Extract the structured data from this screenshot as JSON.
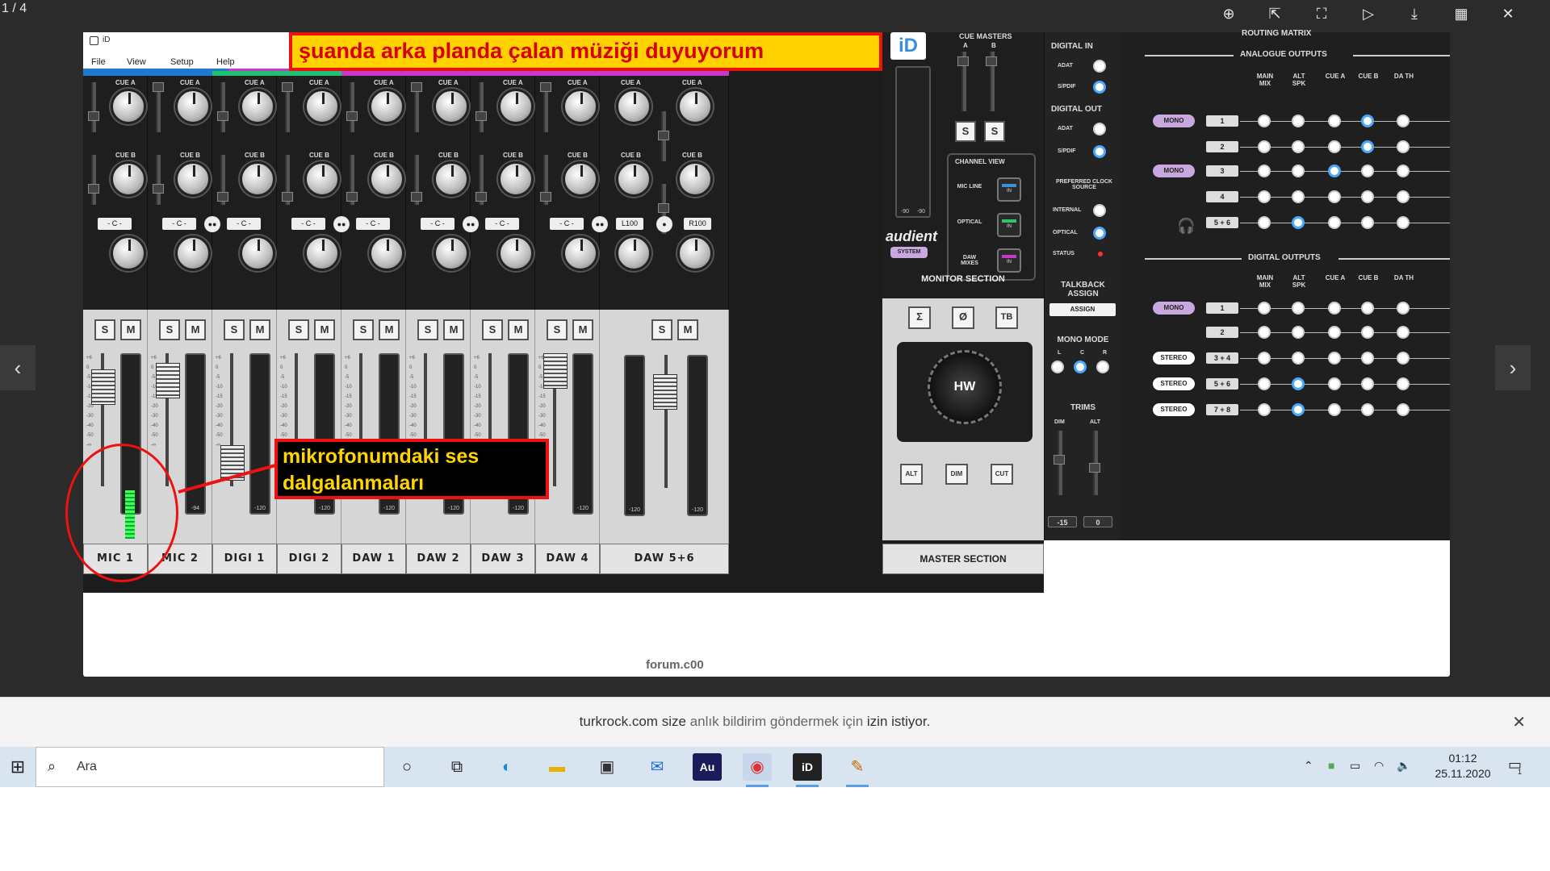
{
  "viewer": {
    "counter": "1 / 4",
    "toolbar_icons": [
      "zoom-in-icon",
      "open-external-icon",
      "fullscreen-icon",
      "slideshow-play-icon",
      "download-icon",
      "grid-view-icon",
      "close-icon"
    ],
    "watermark": "forum.c00"
  },
  "app": {
    "title": "iD",
    "menus": [
      "File",
      "View",
      "Setup",
      "Help"
    ]
  },
  "annotations": {
    "top": "şuanda arka planda çalan müziği duyuyorum",
    "mic": "mikrofonumdaki ses dalgalanmaları"
  },
  "channels": [
    {
      "name": "MIC 1",
      "pan": "- C -",
      "meter": "-48",
      "color": "#1f78d1"
    },
    {
      "name": "MIC 2",
      "pan": "- C -",
      "meter": "-94",
      "color": "#1f78d1"
    },
    {
      "name": "DIGI 1",
      "pan": "- C -",
      "meter": "-120",
      "color": "#21c06e"
    },
    {
      "name": "DIGI 2",
      "pan": "- C -",
      "meter": "-120",
      "color": "#21c06e"
    },
    {
      "name": "DAW 1",
      "pan": "- C -",
      "meter": "-120",
      "color": "#c53ac9"
    },
    {
      "name": "DAW 2",
      "pan": "- C -",
      "meter": "-120",
      "color": "#c53ac9"
    },
    {
      "name": "DAW 3",
      "pan": "- C -",
      "meter": "-120",
      "color": "#c53ac9"
    },
    {
      "name": "DAW 4",
      "pan": "- C -",
      "meter": "-120",
      "color": "#c53ac9"
    },
    {
      "name": "DAW 5+6",
      "pan_l": "L100",
      "pan_r": "R100",
      "meter_l": "-120",
      "meter_r": "-120",
      "color": "#c53ac9"
    }
  ],
  "strip_labels": {
    "cue_a": "CUE A",
    "cue_b": "CUE B",
    "solo": "S",
    "mute": "M"
  },
  "fader_scale": [
    "+6",
    "0",
    "-5",
    "-10",
    "-15",
    "-20",
    "-30",
    "-40",
    "-50",
    "-∞"
  ],
  "master": {
    "name": "MASTER SECTION",
    "cue_masters": "CUE MASTERS",
    "cue_a": "A",
    "cue_b": "B",
    "solo": "S",
    "meter_l": "-90",
    "meter_r": "-90",
    "brand": "audient",
    "system": "SYSTEM",
    "channel_view": "CHANNEL VIEW",
    "views": [
      {
        "label": "MIC LINE",
        "state": "IN",
        "color": "#3b8fd8"
      },
      {
        "label": "OPTICAL",
        "state": "IN",
        "color": "#2ec46e"
      },
      {
        "label": "DAW MIXES",
        "state": "IN",
        "color": "#c53ac9"
      }
    ],
    "monitor_section": "MONITOR SECTION",
    "buttons": [
      "Σ",
      "Ø",
      "TB"
    ],
    "hw": "HW",
    "bottom_buttons": [
      "ALT",
      "DIM",
      "CUT"
    ]
  },
  "digital": {
    "digital_in": "DIGITAL IN",
    "in_opts": [
      "ADAT",
      "S/PDIF"
    ],
    "digital_out": "DIGITAL OUT",
    "out_opts": [
      "ADAT",
      "S/PDIF"
    ],
    "clock_title": "PREFERRED CLOCK SOURCE",
    "clock_opts": [
      "INTERNAL",
      "OPTICAL",
      "STATUS"
    ],
    "talkback": "TALKBACK ASSIGN",
    "assign": "ASSIGN",
    "mono_mode": "MONO MODE",
    "mono_lcr": [
      "L",
      "C",
      "R"
    ],
    "trims": "TRIMS",
    "trim_labels": [
      "DIM",
      "ALT"
    ],
    "trim_values": [
      "-15",
      "0"
    ]
  },
  "routing": {
    "title": "ROUTING MATRIX",
    "analogue": "ANALOGUE OUTPUTS",
    "digital": "DIGITAL OUTPUTS",
    "cols": [
      "MAIN MIX",
      "ALT SPK",
      "CUE A",
      "CUE B",
      "DA TH"
    ],
    "analogue_rows": [
      {
        "tag": "MONO",
        "outs": [
          "1",
          "2"
        ]
      },
      {
        "tag": "MONO",
        "outs": [
          "3",
          "4"
        ]
      },
      {
        "tag": "headphones-icon",
        "outs": [
          "5 + 6"
        ]
      }
    ],
    "digital_rows": [
      {
        "tag": "MONO",
        "outs": [
          "1",
          "2"
        ]
      },
      {
        "tag": "STEREO",
        "outs": [
          "3 + 4"
        ]
      },
      {
        "tag": "STEREO",
        "outs": [
          "5 + 6"
        ]
      },
      {
        "tag": "STEREO",
        "outs": [
          "7 + 8"
        ]
      }
    ]
  },
  "notification": {
    "site": "turkrock.com",
    "text_a": "size",
    "text_b": "anlık bildirim göndermek için",
    "text_c": "izin istiyor."
  },
  "taskbar": {
    "search_placeholder": "Ara",
    "apps": [
      "cortana-icon",
      "task-view-icon",
      "edge-icon",
      "file-explorer-icon",
      "store-icon",
      "mail-icon",
      "audition-icon",
      "chrome-icon",
      "id-app-icon",
      "paint-icon"
    ],
    "clock_time": "01:12",
    "clock_date": "25.11.2020",
    "notif_count": "1"
  }
}
